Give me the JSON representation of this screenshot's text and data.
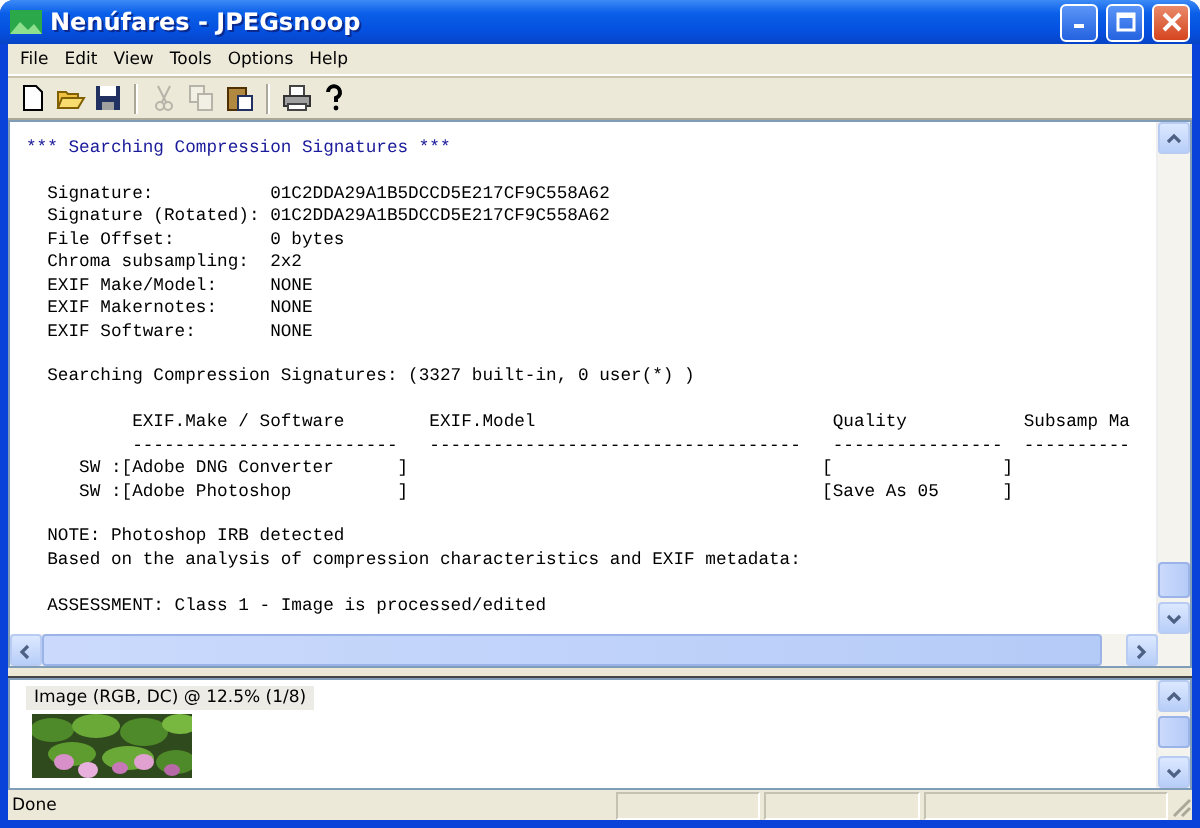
{
  "window": {
    "title": "Nenúfares - JPEGsnoop"
  },
  "menu": [
    "File",
    "Edit",
    "View",
    "Tools",
    "Options",
    "Help"
  ],
  "toolbar": [
    {
      "kind": "new",
      "disabled": false
    },
    {
      "kind": "open",
      "disabled": false
    },
    {
      "kind": "save",
      "disabled": false
    },
    {
      "kind": "separator"
    },
    {
      "kind": "cut",
      "disabled": true
    },
    {
      "kind": "copy",
      "disabled": true
    },
    {
      "kind": "paste",
      "disabled": false
    },
    {
      "kind": "separator"
    },
    {
      "kind": "print",
      "disabled": false
    },
    {
      "kind": "help",
      "disabled": false
    }
  ],
  "report": {
    "lines": [
      {
        "kind": "heading",
        "text": "*** Searching Compression Signatures ***"
      },
      {
        "kind": "blank"
      },
      {
        "kind": "text",
        "text": "  Signature:           01C2DDA29A1B5DCCD5E217CF9C558A62"
      },
      {
        "kind": "text",
        "text": "  Signature (Rotated): 01C2DDA29A1B5DCCD5E217CF9C558A62"
      },
      {
        "kind": "text",
        "text": "  File Offset:         0 bytes"
      },
      {
        "kind": "text",
        "text": "  Chroma subsampling:  2x2"
      },
      {
        "kind": "text",
        "text": "  EXIF Make/Model:     NONE"
      },
      {
        "kind": "text",
        "text": "  EXIF Makernotes:     NONE"
      },
      {
        "kind": "text",
        "text": "  EXIF Software:       NONE"
      },
      {
        "kind": "blank"
      },
      {
        "kind": "text",
        "text": "  Searching Compression Signatures: (3327 built-in, 0 user(*) )"
      },
      {
        "kind": "blank"
      },
      {
        "kind": "text",
        "text": "          EXIF.Make / Software        EXIF.Model                            Quality           Subsamp Ma"
      },
      {
        "kind": "text",
        "text": "          -------------------------   -----------------------------------   ----------------  ----------"
      },
      {
        "kind": "text",
        "text": "     SW :[Adobe DNG Converter      ]                                       [                ]"
      },
      {
        "kind": "text",
        "text": "     SW :[Adobe Photoshop          ]                                       [Save As 05      ]"
      },
      {
        "kind": "blank"
      },
      {
        "kind": "text",
        "text": "  NOTE: Photoshop IRB detected"
      },
      {
        "kind": "text",
        "text": "  Based on the analysis of compression characteristics and EXIF metadata:"
      },
      {
        "kind": "blank"
      },
      {
        "kind": "text",
        "text": "  ASSESSMENT: Class 1 - Image is processed/edited"
      }
    ]
  },
  "image_pane": {
    "caption": "Image (RGB, DC) @ 12.5% (1/8)"
  },
  "status_bar": {
    "text": "Done"
  }
}
